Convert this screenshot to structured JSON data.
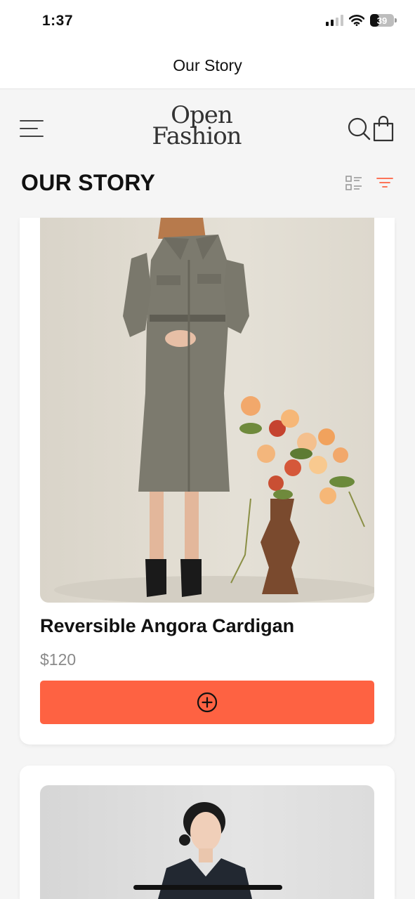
{
  "status_bar": {
    "time": "1:37",
    "battery": "39",
    "battery_level": 0.39
  },
  "nav": {
    "title": "Our Story"
  },
  "header": {
    "logo_line1": "Open",
    "logo_line2": "Fashion",
    "menu_icon": "hamburger-menu-icon",
    "search_icon": "search-icon",
    "bag_icon": "shopping-bag-icon"
  },
  "section": {
    "title": "OUR STORY",
    "view_icon": "list-view-icon",
    "filter_icon": "filter-icon"
  },
  "products": [
    {
      "name": "Reversible Angora Cardigan",
      "price": "$120",
      "add_icon": "add-circle-icon"
    },
    {
      "name": "",
      "price": ""
    }
  ],
  "colors": {
    "accent": "#fe6242",
    "filter_icon": "#fe6242",
    "background": "#f5f5f5"
  }
}
